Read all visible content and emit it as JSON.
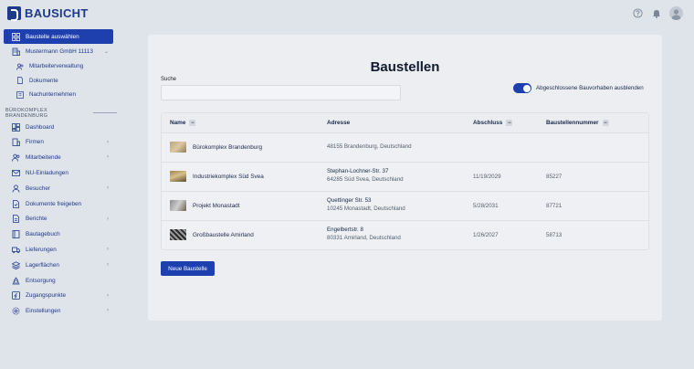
{
  "app": {
    "logo_text": "BAUSICHT"
  },
  "header": {
    "icons": [
      "help-icon",
      "bell-icon",
      "avatar"
    ]
  },
  "sidebar": {
    "active_item": "Baustelle auswählen",
    "org": "Mustermann GmbH 11113",
    "org_sub": [
      "Mitarbeiterverwaltung",
      "Dokumente",
      "Nachunternehmen"
    ],
    "section": "BÜROKOMPLEX BRANDENBURG",
    "items": [
      {
        "label": "Dashboard",
        "chevron": false
      },
      {
        "label": "Firmen",
        "chevron": true
      },
      {
        "label": "Mitarbeitende",
        "chevron": true
      },
      {
        "label": "NU-Einladungen",
        "chevron": false
      },
      {
        "label": "Besucher",
        "chevron": true
      },
      {
        "label": "Dokumente freigeben",
        "chevron": false
      },
      {
        "label": "Berichte",
        "chevron": true
      },
      {
        "label": "Bautagebuch",
        "chevron": false
      },
      {
        "label": "Lieferungen",
        "chevron": true
      },
      {
        "label": "Lagerflächen",
        "chevron": true
      },
      {
        "label": "Entsorgung",
        "chevron": false
      },
      {
        "label": "Zugangspunkte",
        "chevron": true
      },
      {
        "label": "Einstellungen",
        "chevron": true
      }
    ]
  },
  "main": {
    "title": "Baustellen",
    "search": {
      "label": "Suche",
      "value": "",
      "placeholder": ""
    },
    "toggle": {
      "label": "Abgeschlossene Bauvorhaben ausblenden",
      "on": true
    },
    "table": {
      "headers": {
        "name": "Name",
        "address": "Adresse",
        "end": "Abschluss",
        "number": "Baustellennummer"
      },
      "rows": [
        {
          "name": "Bürokomplex Brandenburg",
          "addr1": "",
          "addr2": "48155 Brandenburg, Deutschland",
          "end": "",
          "number": ""
        },
        {
          "name": "Industriekomplex Süd Svea",
          "addr1": "Stephan-Lochner-Str. 37",
          "addr2": "64285 Süd Svea, Deutschland",
          "end": "11/19/2029",
          "number": "85227"
        },
        {
          "name": "Projekt Monastadt",
          "addr1": "Quettinger Str. 53",
          "addr2": "10245 Monastadt, Deutschland",
          "end": "5/28/2031",
          "number": "87721"
        },
        {
          "name": "Großbaustelle Amirland",
          "addr1": "Engelbertstr. 8",
          "addr2": "80331 Amirland, Deutschland",
          "end": "1/26/2027",
          "number": "58713"
        }
      ]
    },
    "new_button": "Neue Baustelle"
  },
  "colors": {
    "accent": "#1e40af",
    "brand": "#1e3a8a",
    "background": "#dfe3ea",
    "panel": "#eceef2"
  }
}
